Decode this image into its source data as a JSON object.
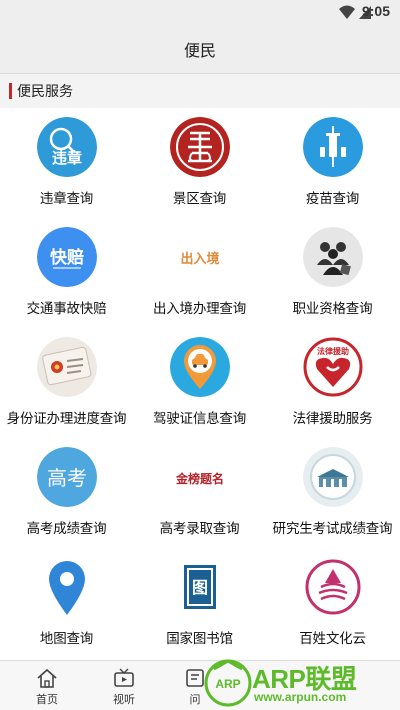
{
  "statusbar": {
    "time": "9:05"
  },
  "header": {
    "title": "便民"
  },
  "section": {
    "label": "便民服务"
  },
  "services": [
    {
      "label": "违章查询",
      "icon": "traffic-violation-icon",
      "icon_text": "违章"
    },
    {
      "label": "景区查询",
      "icon": "scenic-seal-icon"
    },
    {
      "label": "疫苗查询",
      "icon": "vaccine-syringe-icon"
    },
    {
      "label": "交通事故快赔",
      "icon": "quick-claim-icon",
      "icon_text": "快赔"
    },
    {
      "label": "出入境办理查询",
      "icon": "entry-exit-icon",
      "icon_text": "出入境"
    },
    {
      "label": "职业资格查询",
      "icon": "professional-group-icon"
    },
    {
      "label": "身份证办理进度查询",
      "icon": "id-card-icon"
    },
    {
      "label": "驾驶证信息查询",
      "icon": "car-location-icon"
    },
    {
      "label": "法律援助服务",
      "icon": "legal-aid-icon",
      "icon_text": "法律援助"
    },
    {
      "label": "高考成绩查询",
      "icon": "gaokao-icon",
      "icon_text": "高考"
    },
    {
      "label": "高考录取查询",
      "icon": "admission-calligraphy-icon",
      "icon_text": "金榜题名"
    },
    {
      "label": "研究生考试成绩查询",
      "icon": "graduate-exam-icon"
    },
    {
      "label": "地图查询",
      "icon": "map-pin-icon"
    },
    {
      "label": "国家图书馆",
      "icon": "national-library-icon",
      "icon_text": "图"
    },
    {
      "label": "百姓文化云",
      "icon": "culture-cloud-icon"
    }
  ],
  "tabbar": {
    "tabs": [
      {
        "label": "首页",
        "icon": "home-icon"
      },
      {
        "label": "视听",
        "icon": "tv-icon"
      },
      {
        "label": "问",
        "icon": "ask-icon"
      }
    ]
  },
  "watermark": {
    "badge": "ARP",
    "brand": "ARP联盟",
    "url": "www.arpun.com"
  },
  "colors": {
    "accent": "#c0282a",
    "header_bg": "#eeeeee",
    "watermark": "#5dbb2a"
  }
}
